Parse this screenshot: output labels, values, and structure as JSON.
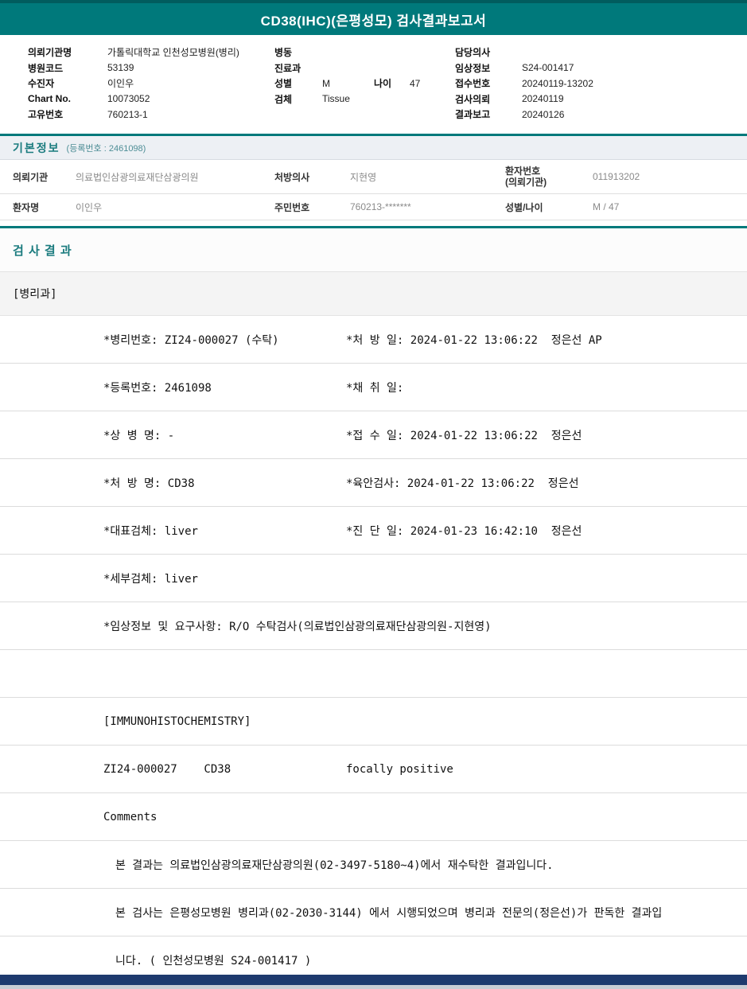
{
  "colors": {
    "teal_accent": "#00797B",
    "footer_navy": "#1E3A6E",
    "section_text": "#1A7B7E"
  },
  "title_bar": {
    "title": "CD38(IHC)(은평성모) 검사결과보고서"
  },
  "patient_header": {
    "col1": [
      {
        "label": "의뢰기관명",
        "value": "가톨릭대학교 인천성모병원(병리)"
      },
      {
        "label": "병원코드",
        "value": "53139"
      },
      {
        "label": "수진자",
        "value": "이인우"
      },
      {
        "label": "Chart No.",
        "value": "10073052"
      },
      {
        "label": "고유번호",
        "value": "760213-1"
      }
    ],
    "col2": [
      {
        "label": "병동",
        "value": ""
      },
      {
        "label": "진료과",
        "value": ""
      },
      {
        "label": "성별",
        "value": "M"
      },
      {
        "label": "검체",
        "value": "Tissue"
      }
    ],
    "age": {
      "label": "나이",
      "value": "47"
    },
    "col3": [
      {
        "label": "담당의사",
        "value": ""
      },
      {
        "label": "임상정보",
        "value": "S24-001417"
      },
      {
        "label": "접수번호",
        "value": "20240119-13202"
      },
      {
        "label": "검사의뢰",
        "value": "20240119"
      },
      {
        "label": "결과보고",
        "value": "20240126"
      }
    ]
  },
  "basic_info": {
    "title": "기본정보",
    "subtitle": "(등록번호 : 2461098)",
    "row1": {
      "c1_label": "의뢰기관",
      "c1_value": "의료법인삼광의료재단삼광의원",
      "c2_label": "처방의사",
      "c2_value": "지현영",
      "c3_label": "환자번호",
      "c3_label_sub": "(의뢰기관)",
      "c3_value": "011913202"
    },
    "row2": {
      "c1_label": "환자명",
      "c1_value": "이인우",
      "c2_label": "주민번호",
      "c2_value": "760213-*******",
      "c3_label": "성별/나이",
      "c3_value": "M / 47"
    }
  },
  "results": {
    "section_title": "검 사 결 과",
    "department": "[병리과]",
    "rows": [
      {
        "left": "*병리번호: ZI24-000027 (수탁)",
        "right": "*처 방 일: 2024-01-22 13:06:22  정은선 AP"
      },
      {
        "left": "*등록번호: 2461098",
        "right": "*채 취 일:"
      },
      {
        "left": "*상 병 명: -",
        "right": "*접 수 일: 2024-01-22 13:06:22  정은선"
      },
      {
        "left": "*처 방 명: CD38",
        "right": "*육안검사: 2024-01-22 13:06:22  정은선"
      },
      {
        "left": "*대표검체: liver",
        "right": "*진 단 일: 2024-01-23 16:42:10  정은선"
      },
      {
        "left": "*세부검체: liver",
        "right": ""
      },
      {
        "left": "*임상정보 및 요구사항: R/O 수탁검사(의료법인삼광의료재단삼광의원-지현영)",
        "right": ""
      },
      {
        "left": "",
        "right": ""
      },
      {
        "left": "[IMMUNOHISTOCHEMISTRY]",
        "right": ""
      },
      {
        "left": "ZI24-000027    CD38",
        "right": "focally positive"
      },
      {
        "left": "Comments",
        "right": ""
      },
      {
        "left": "본 결과는 의료법인삼광의료재단삼광의원(02-3497-5180~4)에서 재수탁한 결과입니다.",
        "right": ""
      },
      {
        "left": "본 검사는 은평성모병원 병리과(02-2030-3144) 에서 시행되었으며 병리과 전문의(정은선)가 판독한 결과입",
        "right": ""
      },
      {
        "left": "니다. ( 인천성모병원 S24-001417 )",
        "right": ""
      }
    ]
  }
}
